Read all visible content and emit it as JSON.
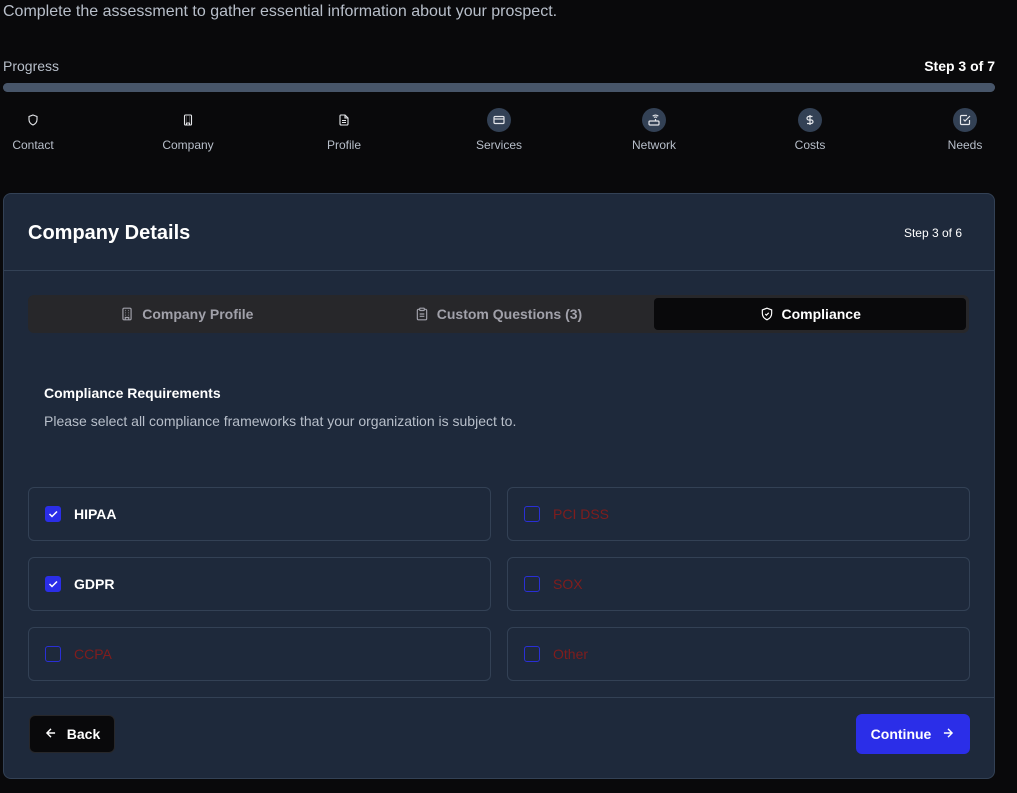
{
  "page": {
    "subtitle": "Complete the assessment to gather essential information about your prospect."
  },
  "progress": {
    "label": "Progress",
    "step_text": "Step 3 of 7",
    "fraction": 1.0
  },
  "stepper": [
    {
      "label": "Contact",
      "icon": "shield-icon"
    },
    {
      "label": "Company",
      "icon": "building-icon"
    },
    {
      "label": "Profile",
      "icon": "file-text-icon"
    },
    {
      "label": "Services",
      "icon": "credit-card-icon"
    },
    {
      "label": "Network",
      "icon": "router-icon"
    },
    {
      "label": "Costs",
      "icon": "dollar-icon"
    },
    {
      "label": "Needs",
      "icon": "check-square-icon"
    }
  ],
  "card": {
    "title": "Company Details",
    "step_text": "Step 3 of 6"
  },
  "tabs": [
    {
      "label": "Company Profile",
      "icon": "building-icon",
      "active": false
    },
    {
      "label": "Custom Questions (3)",
      "icon": "clipboard-icon",
      "active": false
    },
    {
      "label": "Compliance",
      "icon": "shield-check-icon",
      "active": true
    }
  ],
  "compliance": {
    "title": "Compliance Requirements",
    "description": "Please select all compliance frameworks that your organization is subject to.",
    "options": [
      {
        "label": "HIPAA",
        "checked": true
      },
      {
        "label": "PCI DSS",
        "checked": false
      },
      {
        "label": "GDPR",
        "checked": true
      },
      {
        "label": "SOX",
        "checked": false
      },
      {
        "label": "CCPA",
        "checked": false
      },
      {
        "label": "Other",
        "checked": false
      }
    ]
  },
  "footer": {
    "back_label": "Back",
    "continue_label": "Continue"
  },
  "colors": {
    "accent": "#2b2ee8",
    "card_bg": "#1e293b",
    "unchecked_text": "#7f1d1d"
  }
}
